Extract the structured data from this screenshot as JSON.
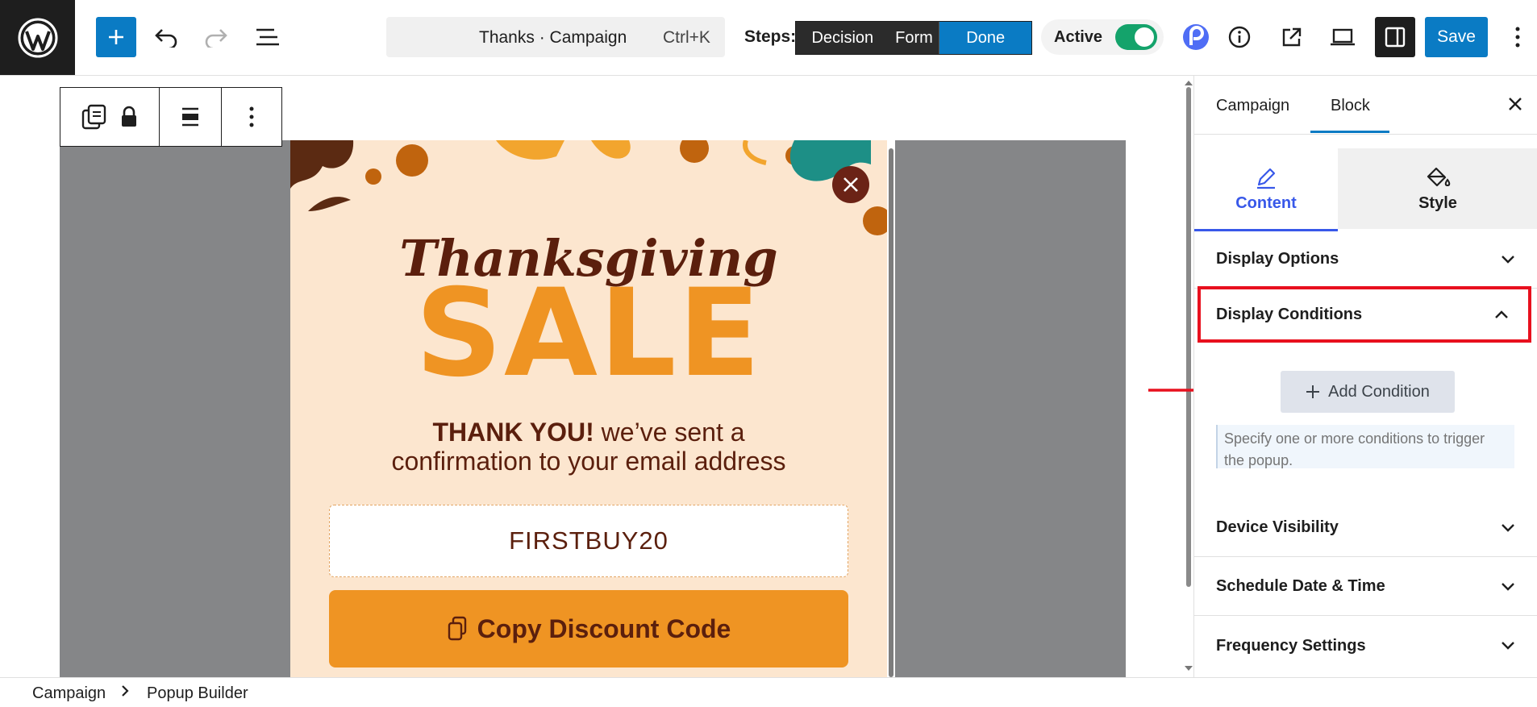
{
  "header": {
    "command_title": "Thanks · Campaign",
    "command_shortcut": "Ctrl+K",
    "steps_label": "Steps:",
    "steps": [
      "Decision",
      "Form",
      "Done"
    ],
    "active_step": "Done",
    "active_label": "Active",
    "active_toggle_on": true,
    "save_label": "Save",
    "accent_color": "#0a7bc4"
  },
  "popup": {
    "title_script": "Thanksgiving",
    "title_big": "SALE",
    "confirm_bold": "THANK YOU!",
    "confirm_rest": " we’ve sent a",
    "confirm_line2": "confirmation to your email address",
    "coupon_code": "FIRSTBUY20",
    "copy_button": "Copy Discount Code",
    "background_color": "#fce6cf",
    "accent_color": "#ef9423"
  },
  "sidebar": {
    "tabs": [
      "Campaign",
      "Block"
    ],
    "active_tab": "Block",
    "subtabs": [
      "Content",
      "Style"
    ],
    "active_subtab": "Content",
    "sections": {
      "display_options": "Display Options",
      "display_conditions": "Display Conditions",
      "device_visibility": "Device Visibility",
      "schedule": "Schedule Date & Time",
      "frequency": "Frequency Settings"
    },
    "add_condition_label": "Add Condition",
    "hint": "Specify one or more conditions to trigger the popup."
  },
  "breadcrumb": [
    "Campaign",
    "Popup Builder"
  ]
}
